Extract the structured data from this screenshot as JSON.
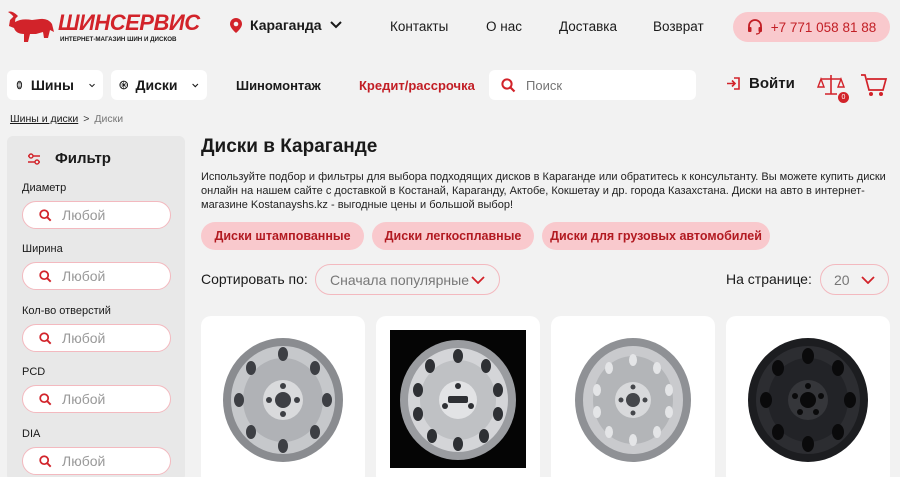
{
  "header": {
    "logo_name": "ШИНСЕРВИС",
    "logo_tagline": "ИНТЕРНЕТ-МАГАЗИН ШИН И ДИСКОВ",
    "city": "Караганда",
    "links": [
      "Контакты",
      "О нас",
      "Доставка",
      "Возврат"
    ],
    "phone": "+7 771 058 81 88"
  },
  "nav": {
    "tires": "Шины",
    "wheels": "Диски",
    "tire_fitting": "Шиномонтаж",
    "credit": "Кредит/рассрочка",
    "search_placeholder": "Поиск",
    "login": "Войти",
    "compare_count": "0"
  },
  "breadcrumb": {
    "parent": "Шины и диски",
    "sep": ">",
    "current": "Диски"
  },
  "filter": {
    "title": "Фильтр",
    "fields": [
      {
        "label": "Диаметр",
        "value": "Любой"
      },
      {
        "label": "Ширина",
        "value": "Любой"
      },
      {
        "label": "Кол-во отверстий",
        "value": "Любой"
      },
      {
        "label": "PCD",
        "value": "Любой"
      },
      {
        "label": "DIA",
        "value": "Любой"
      }
    ]
  },
  "main": {
    "title": "Диски в Караганде",
    "description": "Используйте подбор и фильтры для выбора подходящих дисков в Караганде или обратитесь к консультанту. Вы можете купить диски онлайн на нашем сайте с доставкой в Костанай, Караганду, Актобе, Кокшетау и др. города Казахстана. Диски на авто в интернет-магазине Kostanayshs.kz - выгодные цены и большой выбор!",
    "categories": [
      "Диски штампованные",
      "Диски легкосплавные",
      "Диски для грузовых автомобилей"
    ],
    "sort_label": "Сортировать по:",
    "sort_value": "Сначала популярные",
    "per_page_label": "На странице:",
    "per_page_value": "20"
  },
  "colors": {
    "accent": "#d2232a",
    "pill": "#f9c9cd",
    "background": "#f2f2f2"
  }
}
